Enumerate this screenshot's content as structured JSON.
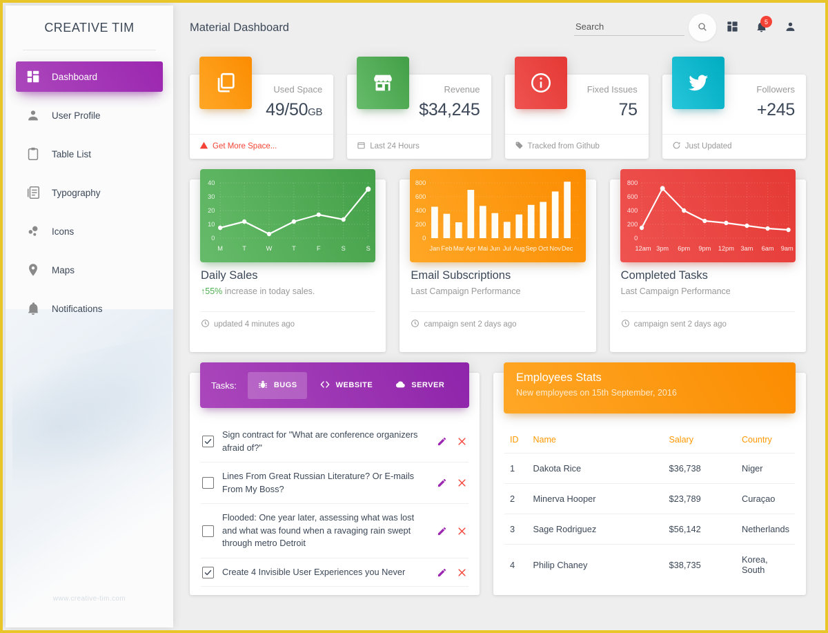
{
  "sidebar": {
    "brand": "CREATIVE TIM",
    "watermark": "www.creative-tim.com",
    "items": [
      {
        "label": "Dashboard",
        "icon": "dashboard-icon",
        "active": true
      },
      {
        "label": "User Profile",
        "icon": "person-icon",
        "active": false
      },
      {
        "label": "Table List",
        "icon": "clipboard-icon",
        "active": false
      },
      {
        "label": "Typography",
        "icon": "article-icon",
        "active": false
      },
      {
        "label": "Icons",
        "icon": "bubble-chart-icon",
        "active": false
      },
      {
        "label": "Maps",
        "icon": "location-pin-icon",
        "active": false
      },
      {
        "label": "Notifications",
        "icon": "bell-icon",
        "active": false
      }
    ]
  },
  "topbar": {
    "title": "Material Dashboard",
    "search_placeholder": "Search",
    "search_value": "",
    "notification_count": "5",
    "icons": [
      "search-icon",
      "dashboard-grid-icon",
      "bell-icon",
      "person-icon"
    ]
  },
  "stats": [
    {
      "category": "Used Space",
      "value": "49/50",
      "unit": "GB",
      "footer": "Get More Space...",
      "footer_icon": "warning-icon",
      "icon": "content-copy-icon",
      "color": "#ff9800",
      "danger": true
    },
    {
      "category": "Revenue",
      "value": "$34,245",
      "unit": "",
      "footer": "Last 24 Hours",
      "footer_icon": "calendar-icon",
      "icon": "store-icon",
      "color": "#4caf50",
      "danger": false
    },
    {
      "category": "Fixed Issues",
      "value": "75",
      "unit": "",
      "footer": "Tracked from Github",
      "footer_icon": "tag-icon",
      "icon": "info-outline-icon",
      "color": "#f44336",
      "danger": false
    },
    {
      "category": "Followers",
      "value": "+245",
      "unit": "",
      "footer": "Just Updated",
      "footer_icon": "update-icon",
      "icon": "twitter-icon",
      "color": "#00bcd4",
      "danger": false
    }
  ],
  "charts": [
    {
      "title": "Daily Sales",
      "subtitle_highlight": "55%",
      "subtitle": " increase in today sales.",
      "footer": "updated 4 minutes ago",
      "footer_icon": "clock-icon",
      "color": "#4caf50"
    },
    {
      "title": "Email Subscriptions",
      "subtitle_highlight": "",
      "subtitle": "Last Campaign Performance",
      "footer": "campaign sent 2 days ago",
      "footer_icon": "clock-icon",
      "color": "#ff9800"
    },
    {
      "title": "Completed Tasks",
      "subtitle_highlight": "",
      "subtitle": "Last Campaign Performance",
      "footer": "campaign sent 2 days ago",
      "footer_icon": "clock-icon",
      "color": "#f44336"
    }
  ],
  "chart_data": [
    {
      "type": "line",
      "title": "Daily Sales",
      "categories": [
        "M",
        "T",
        "W",
        "T",
        "F",
        "S",
        "S"
      ],
      "values": [
        12,
        17,
        7,
        17,
        23,
        18,
        38
      ],
      "ylim": [
        0,
        45
      ],
      "yticks": [
        0,
        10,
        20,
        30,
        40
      ],
      "xlabel": "",
      "ylabel": "",
      "grid": true,
      "legend": "none",
      "series_color": "#ffffff",
      "plot_background": "#4caf50"
    },
    {
      "type": "bar",
      "title": "Email Subscriptions",
      "categories": [
        "Jan",
        "Feb",
        "Mar",
        "Apr",
        "Mai",
        "Jun",
        "Jul",
        "Aug",
        "Sep",
        "Oct",
        "Nov",
        "Dec"
      ],
      "values": [
        542,
        443,
        320,
        780,
        553,
        453,
        326,
        434,
        568,
        610,
        756,
        895
      ],
      "ylim": [
        0,
        900
      ],
      "yticks": [
        0,
        200,
        400,
        600,
        800
      ],
      "xlabel": "",
      "ylabel": "",
      "grid": true,
      "legend": "none",
      "series_color": "#ffffff",
      "plot_background": "#ff9800"
    },
    {
      "type": "line",
      "title": "Completed Tasks",
      "categories": [
        "12am",
        "3pm",
        "6pm",
        "9pm",
        "12pm",
        "3am",
        "6am",
        "9am"
      ],
      "values": [
        230,
        750,
        450,
        300,
        280,
        240,
        200,
        190
      ],
      "ylim": [
        0,
        900
      ],
      "yticks": [
        0,
        200,
        400,
        600,
        800
      ],
      "xlabel": "",
      "ylabel": "",
      "grid": true,
      "legend": "none",
      "series_color": "#ffffff",
      "plot_background": "#f44336"
    }
  ],
  "tasks": {
    "label": "Tasks:",
    "tabs": [
      {
        "label": "BUGS",
        "icon": "bug-icon",
        "active": true
      },
      {
        "label": "WEBSITE",
        "icon": "code-icon",
        "active": false
      },
      {
        "label": "SERVER",
        "icon": "cloud-icon",
        "active": false
      }
    ],
    "items": [
      {
        "text": "Sign contract for \"What are conference organizers afraid of?\"",
        "checked": true
      },
      {
        "text": "Lines From Great Russian Literature? Or E-mails From My Boss?",
        "checked": false
      },
      {
        "text": "Flooded: One year later, assessing what was lost and what was found when a ravaging rain swept through metro Detroit",
        "checked": false
      },
      {
        "text": "Create 4 Invisible User Experiences you Never",
        "checked": true
      }
    ],
    "row_actions": [
      "edit-icon",
      "close-icon"
    ]
  },
  "employees": {
    "title": "Employees Stats",
    "subtitle": "New employees on 15th September, 2016",
    "columns": [
      "ID",
      "Name",
      "Salary",
      "Country"
    ],
    "rows": [
      {
        "id": "1",
        "name": "Dakota Rice",
        "salary": "$36,738",
        "country": "Niger"
      },
      {
        "id": "2",
        "name": "Minerva Hooper",
        "salary": "$23,789",
        "country": "Curaçao"
      },
      {
        "id": "3",
        "name": "Sage Rodriguez",
        "salary": "$56,142",
        "country": "Netherlands"
      },
      {
        "id": "4",
        "name": "Philip Chaney",
        "salary": "$38,735",
        "country": "Korea, South"
      }
    ]
  }
}
